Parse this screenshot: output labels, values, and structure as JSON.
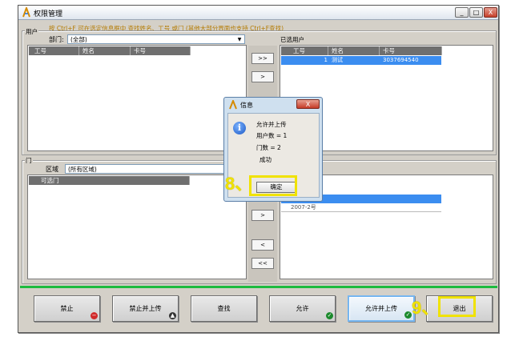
{
  "window": {
    "title": "权限管理",
    "min": "_",
    "max": "□",
    "close": "X"
  },
  "hint": "按 Ctrl+F 可在选定信息框中 查找姓名、工号 或门 (其他大部分界面也支持 Ctrl+F查找)",
  "user_group": {
    "label": "用户",
    "dept_label": "部门:",
    "dept_value": "(全部)",
    "columns": [
      "工号",
      "姓名",
      "卡号"
    ]
  },
  "selected_users": {
    "label": "已选用户",
    "columns": [
      "工号",
      "姓名",
      "卡号"
    ],
    "rows": [
      {
        "id": "1",
        "name": "测试",
        "card": "3037694540"
      }
    ]
  },
  "door_group": {
    "label": "门",
    "area_label": "区域",
    "area_value": "(所有区域)",
    "columns": [
      "可选门"
    ]
  },
  "selected_doors": {
    "rows": [
      {
        "text": ""
      },
      {
        "text": "2007-2号"
      }
    ]
  },
  "move_buttons": {
    "all_right": ">>",
    "right": ">",
    "door_right": ">",
    "door_left": "<",
    "door_all_left": "<<"
  },
  "bottom_buttons": [
    {
      "label": "禁止"
    },
    {
      "label": "禁止并上传"
    },
    {
      "label": "查找"
    },
    {
      "label": "允许"
    },
    {
      "label": "允许并上传"
    },
    {
      "label": "退出"
    }
  ],
  "dialog": {
    "title": "信息",
    "close": "X",
    "lines": [
      "允许并上传",
      "用户数 = 1",
      "门数 = 2",
      "成功"
    ],
    "ok": "确定"
  },
  "annotations": {
    "step8": "8、",
    "step9": "9、"
  },
  "colors": {
    "selection": "#3b8df0",
    "annotation": "#f0e200",
    "divider": "#1dbb3f"
  }
}
